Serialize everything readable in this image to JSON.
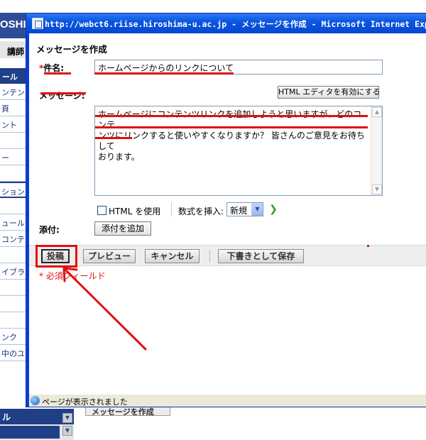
{
  "background": {
    "header_text": "OSHIM",
    "role_text": "講師",
    "sidebar_head": "ール",
    "sidebar_items": [
      "ンテン",
      "頁",
      "ント",
      "",
      "ー",
      "",
      "ション",
      "",
      "ュール",
      "コンテン",
      "",
      "イブラリ",
      "",
      "",
      "",
      "ンク",
      "中のユ"
    ],
    "bottom_head": "ル",
    "bottom_button": "メッセージを作成"
  },
  "window": {
    "title": "http://webct6.riise.hiroshima-u.ac.jp - メッセージを作成 - Microsoft Internet Explorer"
  },
  "form": {
    "page_title": "メッセージを作成",
    "required_mark": "*",
    "subject_label": "件名:",
    "subject_value": "ホームページからのリンクについて",
    "message_label": "メッセージ:",
    "html_editor_button": "HTML エディタを有効にする",
    "message_lines": [
      "ホームページにコンテンツリンクを追加しようと思いますが、どのコンテ",
      "ンツにリンクすると使いやすくなりますか？ 皆さんのご意見をお待ちして",
      "おります。"
    ],
    "html_use_label": "HTML を使用",
    "formula_label": "数式を挿入:",
    "formula_selected": "新規",
    "attach_label": "添付:",
    "attach_button": "添付を追加"
  },
  "actions": {
    "post": "投稿",
    "preview": "プレビュー",
    "cancel": "キャンセル",
    "save_draft": "下書きとして保存"
  },
  "required_note": "* 必須フィールド",
  "status_bar": {
    "text": "ページが表示されました"
  },
  "colors": {
    "annotation": "#e01010",
    "title_bar": "#0a55e0",
    "sidebar_head": "#1f3f87"
  }
}
